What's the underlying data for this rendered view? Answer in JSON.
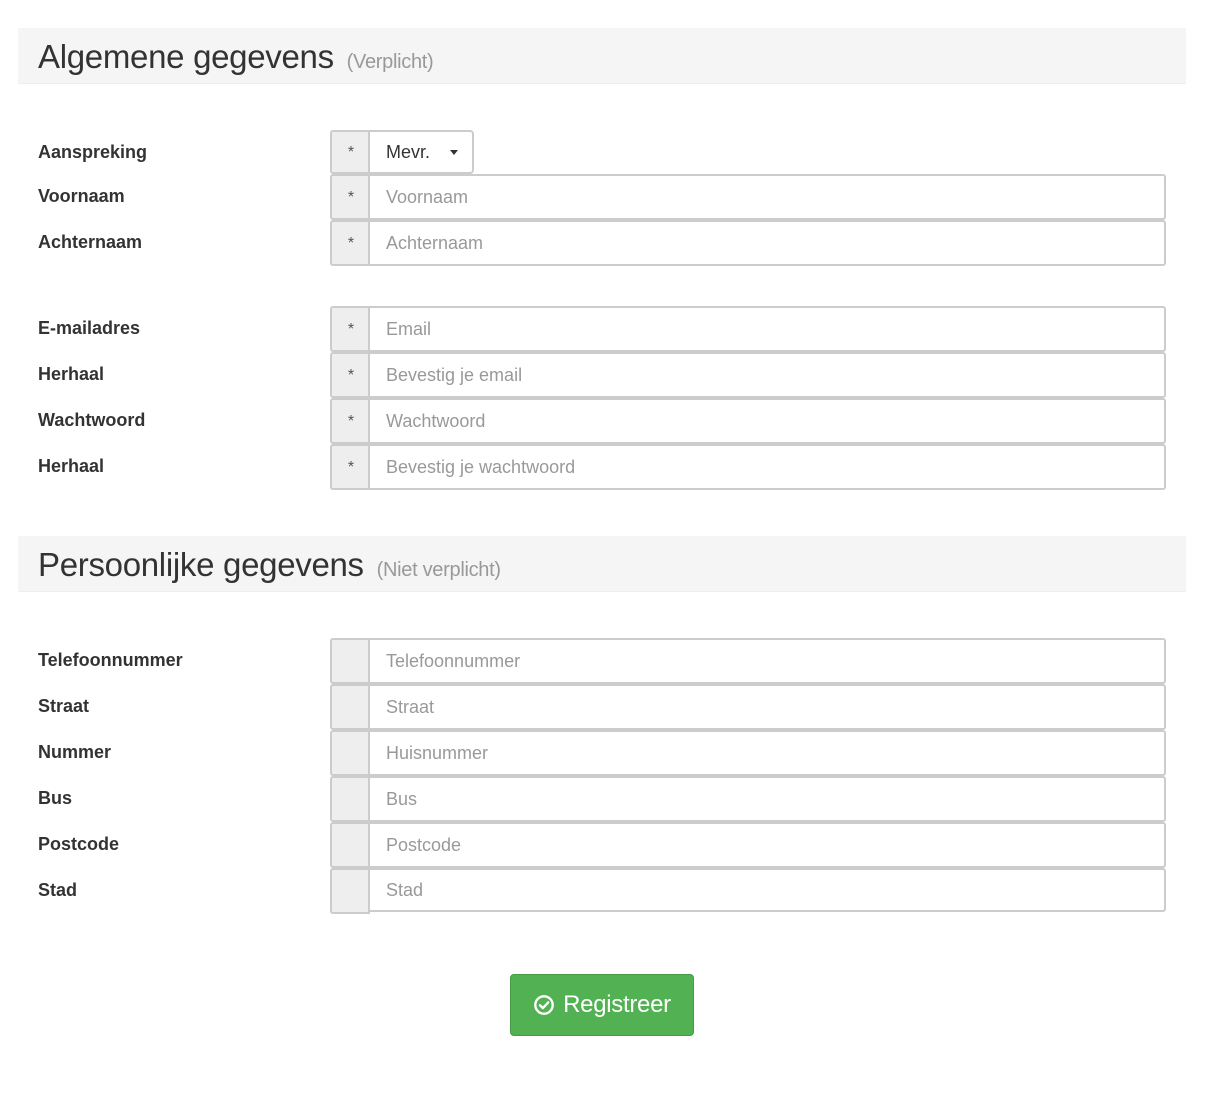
{
  "section_general": {
    "title": "Algemene gegevens",
    "subtitle": "(Verplicht)"
  },
  "general_fields": [
    {
      "label": "Aanspreking",
      "addon": "*",
      "type": "select",
      "value": "Mevr."
    },
    {
      "label": "Voornaam",
      "addon": "*",
      "placeholder": "Voornaam"
    },
    {
      "label": "Achternaam",
      "addon": "*",
      "placeholder": "Achternaam"
    },
    {
      "label": "E-mailadres",
      "addon": "*",
      "placeholder": "Email"
    },
    {
      "label": "Herhaal",
      "addon": "*",
      "placeholder": "Bevestig je email"
    },
    {
      "label": "Wachtwoord",
      "addon": "*",
      "placeholder": "Wachtwoord"
    },
    {
      "label": "Herhaal",
      "addon": "*",
      "placeholder": "Bevestig je wachtwoord"
    }
  ],
  "section_personal": {
    "title": "Persoonlijke gegevens",
    "subtitle": "(Niet verplicht)"
  },
  "personal_fields": [
    {
      "label": "Telefoonnummer",
      "addon": "",
      "placeholder": "Telefoonnummer"
    },
    {
      "label": "Straat",
      "addon": "",
      "placeholder": "Straat"
    },
    {
      "label": "Nummer",
      "addon": "",
      "placeholder": "Huisnummer"
    },
    {
      "label": "Bus",
      "addon": "",
      "placeholder": "Bus"
    },
    {
      "label": "Postcode",
      "addon": "",
      "placeholder": "Postcode"
    },
    {
      "label": "Stad",
      "addon": "",
      "placeholder": "Stad"
    }
  ],
  "submit": {
    "label": "Registreer",
    "icon": "check-circle-icon",
    "color": "#52b152"
  }
}
